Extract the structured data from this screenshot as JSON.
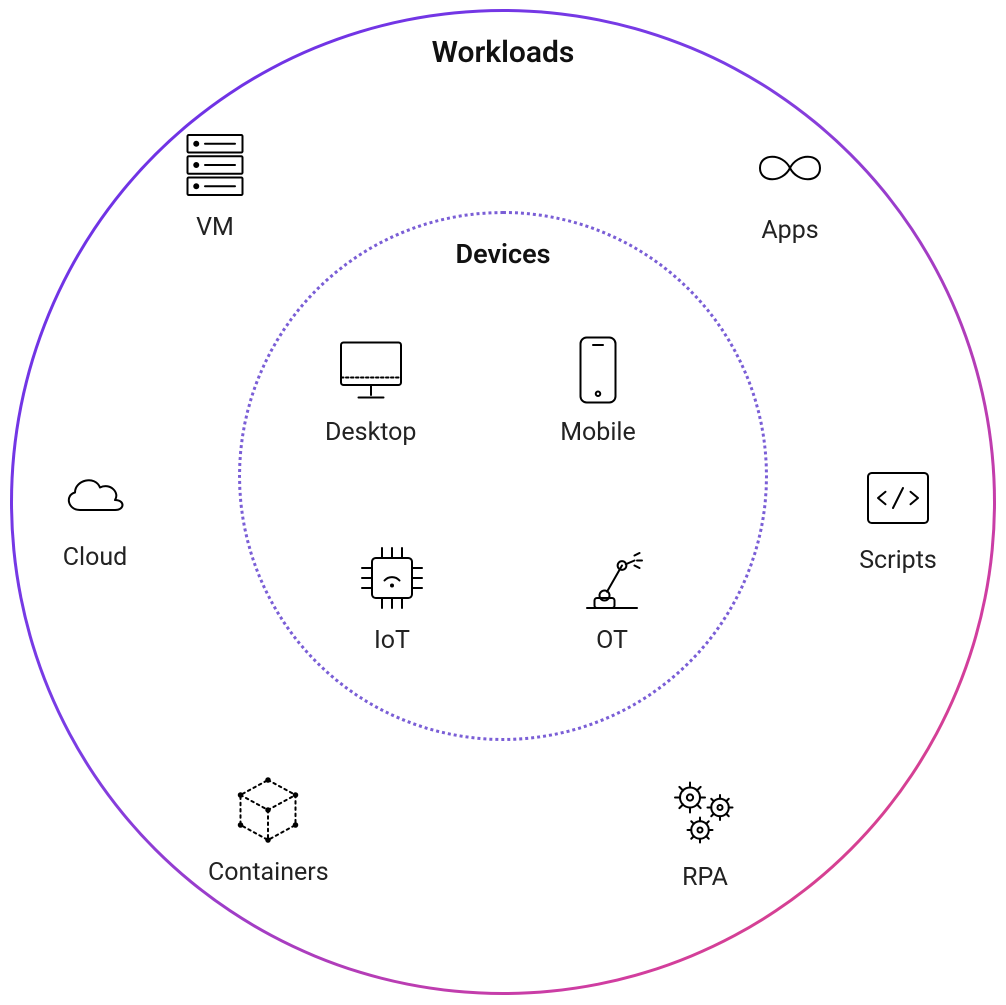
{
  "outer": {
    "title": "Workloads",
    "items": {
      "vm": "VM",
      "apps": "Apps",
      "cloud": "Cloud",
      "scripts": "Scripts",
      "containers": "Containers",
      "rpa": "RPA"
    }
  },
  "inner": {
    "title": "Devices",
    "items": {
      "desktop": "Desktop",
      "mobile": "Mobile",
      "iot": "IoT",
      "ot": "OT"
    }
  },
  "colors": {
    "gradient_start": "#6a2de5",
    "gradient_end": "#e34a6a",
    "inner_border": "#7a5ed6"
  }
}
